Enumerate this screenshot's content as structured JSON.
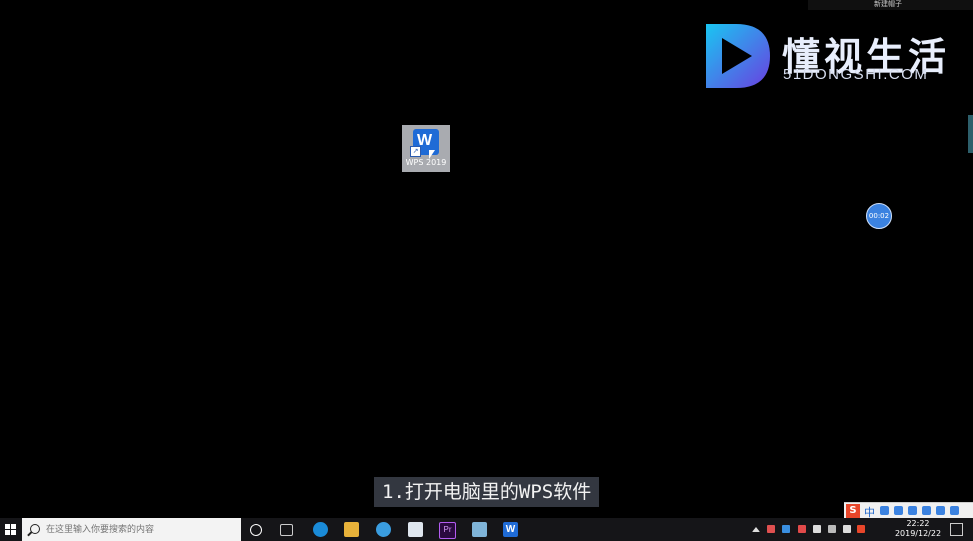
{
  "top_label": "新建帽子",
  "watermark": {
    "brand": "懂视生活",
    "domain": "51DONGSHI.COM"
  },
  "desktop_icon": {
    "label": "WPS 2019",
    "glyph": "W",
    "shortcut_arrow": "↗"
  },
  "recorder": {
    "timer": "00:02"
  },
  "subtitle": "1.打开电脑里的WPS软件",
  "ime": {
    "logo": "S",
    "mode": "中"
  },
  "taskbar": {
    "search_placeholder": "在这里输入你要搜索的内容",
    "apps": [
      "task-view",
      "browser",
      "file-explorer",
      "edge",
      "mail",
      "premiere",
      "notepad",
      "wps"
    ],
    "premiere_label": "Pr",
    "wps_label": "W"
  },
  "clock": {
    "time": "22:22",
    "date": "2019/12/22"
  },
  "colors": {
    "accent": "#3b82e0",
    "wps_blue": "#1f6bd6",
    "premiere": "#2a0a3f",
    "ime_red": "#e8462a"
  }
}
